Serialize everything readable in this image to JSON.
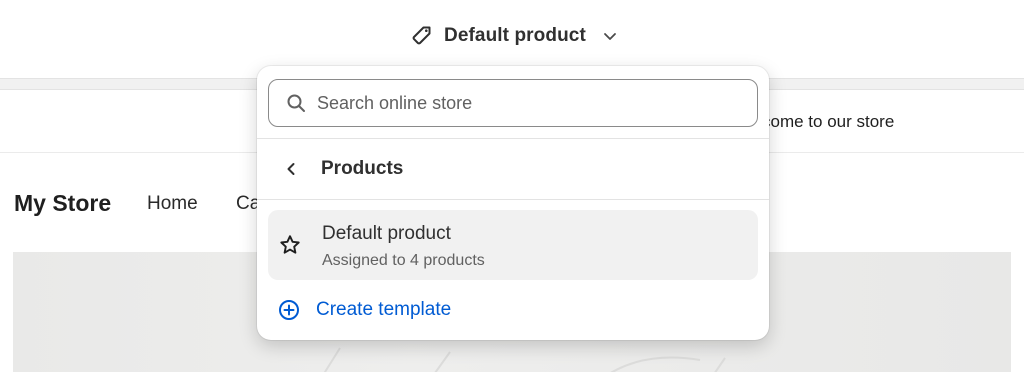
{
  "topbar": {
    "template_label": "Default product",
    "template_icon": "tag-icon",
    "dropdown_icon": "chevron-down-icon"
  },
  "preview": {
    "announcement": "Welcome to our store",
    "announcement_visible": "come to our store",
    "store_name": "My Store",
    "nav": {
      "home": "Home",
      "catalog_visible": "Ca"
    }
  },
  "popover": {
    "search": {
      "placeholder": "Search online store",
      "value": "",
      "icon": "search-icon"
    },
    "back": {
      "icon": "chevron-left-icon",
      "title": "Products"
    },
    "options": [
      {
        "icon": "star-icon",
        "name": "Default product",
        "subtitle": "Assigned to 4 products",
        "selected": true
      }
    ],
    "create": {
      "icon": "plus-circle-icon",
      "label": "Create template"
    }
  },
  "colors": {
    "accent_link": "#005bd3",
    "text_primary": "#303030",
    "text_secondary": "#616161",
    "selected_bg": "#f1f1f1"
  }
}
